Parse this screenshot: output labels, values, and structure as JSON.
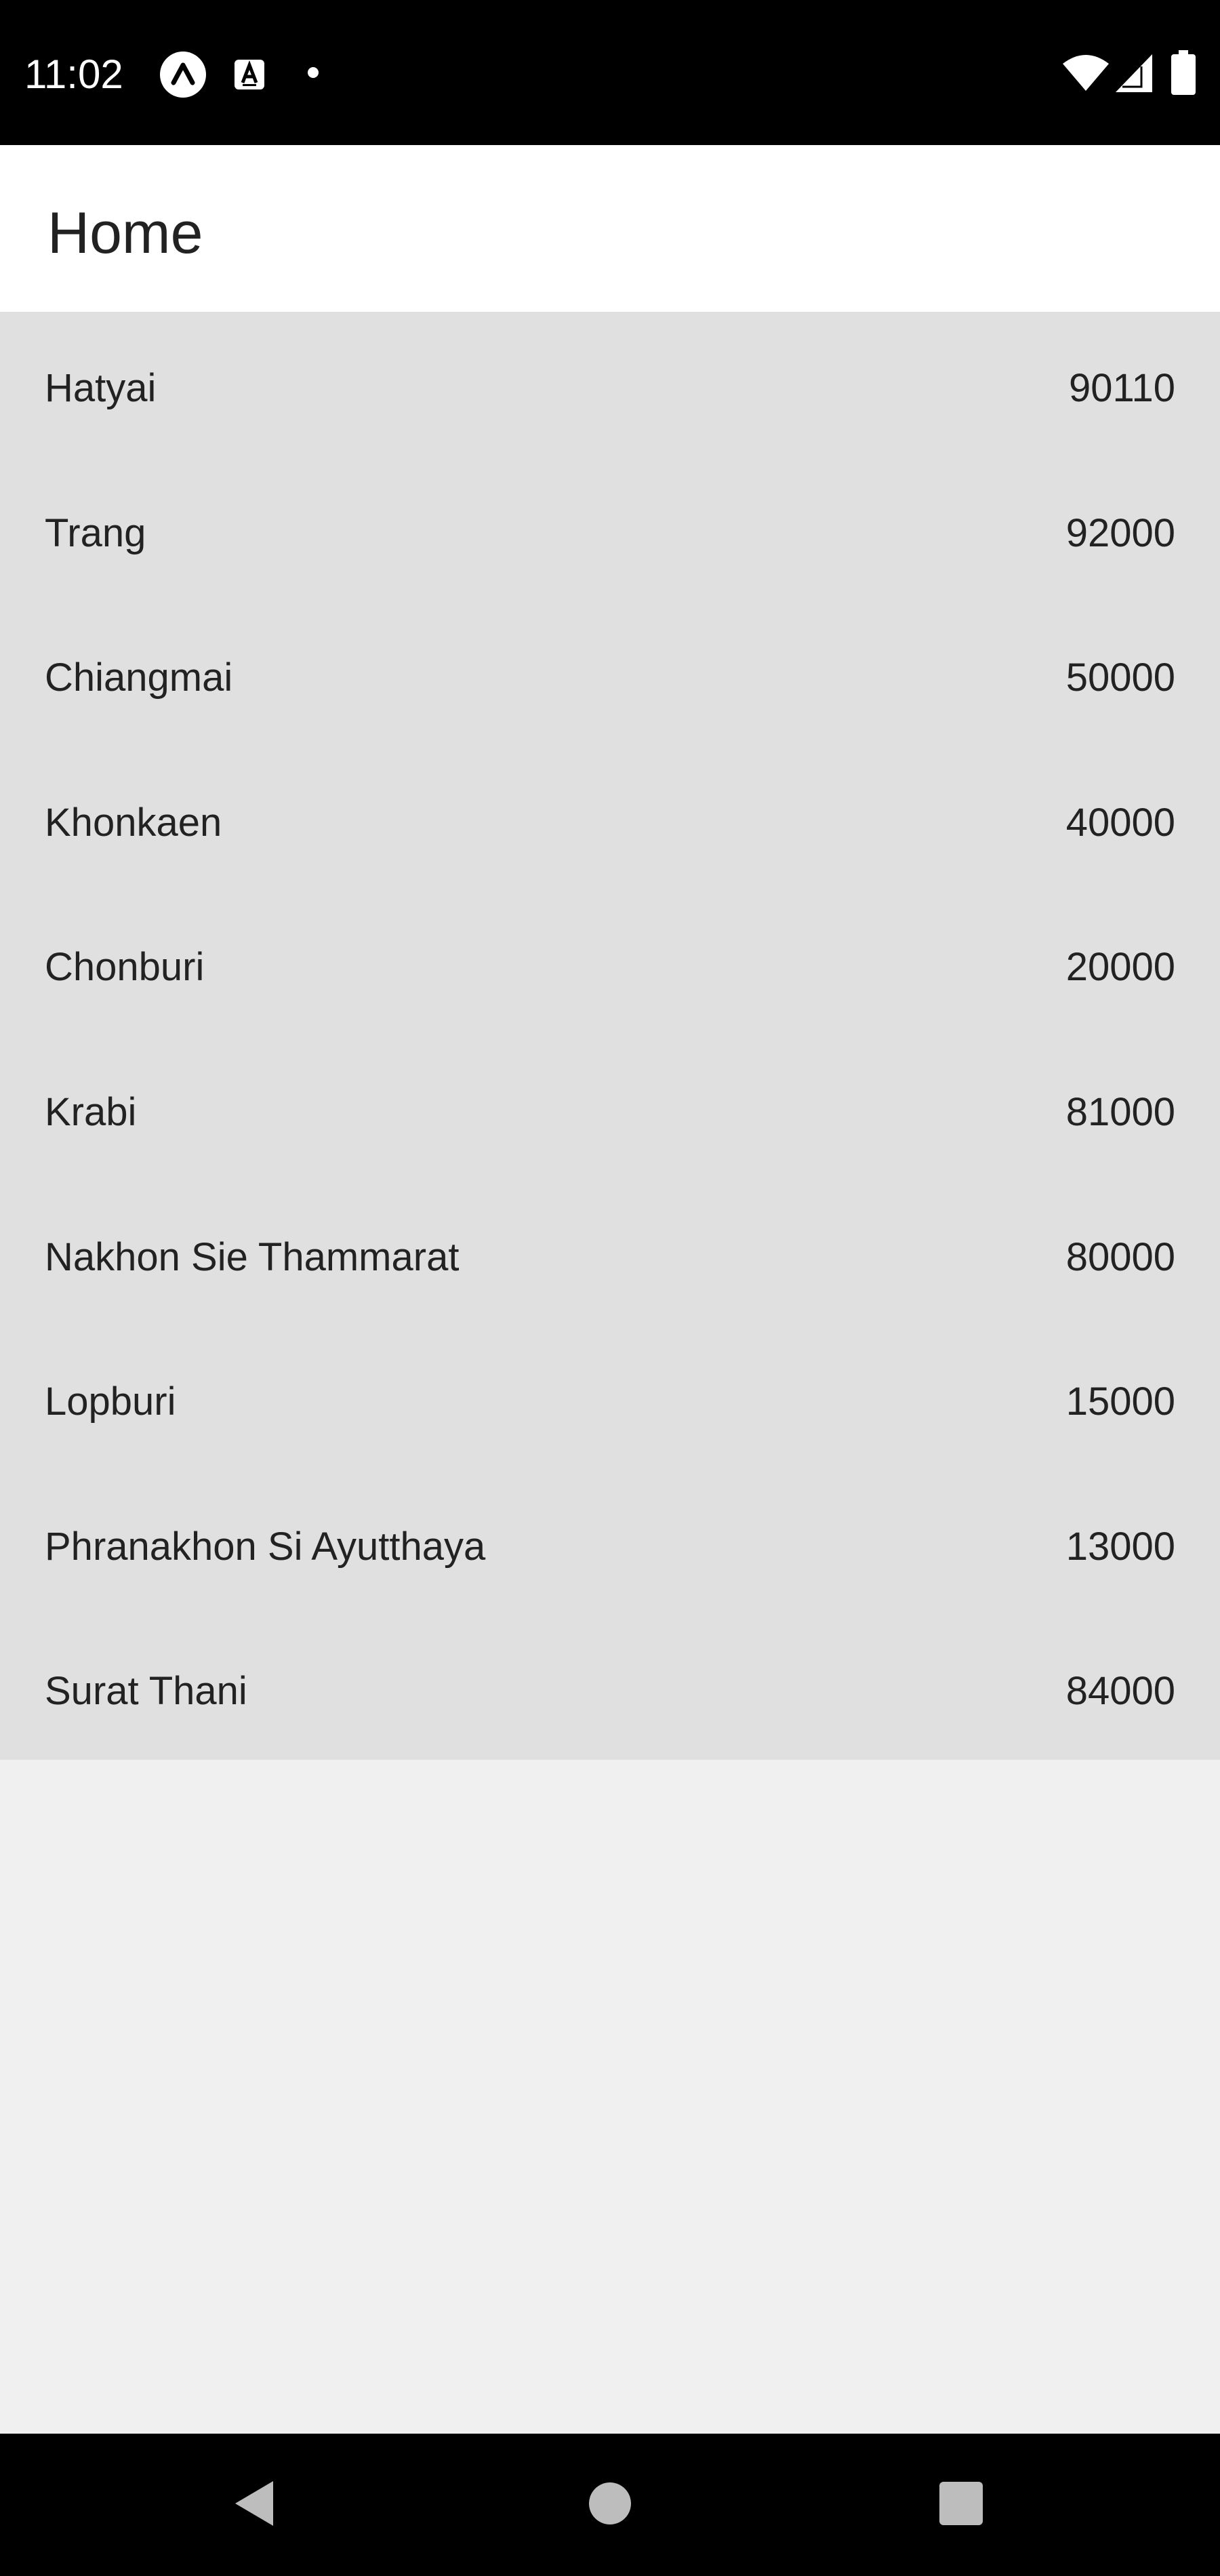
{
  "status_bar": {
    "time": "11:02",
    "icons_left": [
      "expo-icon",
      "keyboard-a-icon",
      "notification-dot-icon"
    ],
    "icons_right": [
      "wifi-icon",
      "cellular-signal-icon",
      "battery-icon"
    ]
  },
  "app_bar": {
    "title": "Home"
  },
  "list": {
    "items": [
      {
        "name": "Hatyai",
        "code": "90110"
      },
      {
        "name": "Trang",
        "code": "92000"
      },
      {
        "name": "Chiangmai",
        "code": "50000"
      },
      {
        "name": "Khonkaen",
        "code": "40000"
      },
      {
        "name": "Chonburi",
        "code": "20000"
      },
      {
        "name": "Krabi",
        "code": "81000"
      },
      {
        "name": "Nakhon Sie Thammarat",
        "code": "80000"
      },
      {
        "name": "Lopburi",
        "code": "15000"
      },
      {
        "name": "Phranakhon Si Ayutthaya",
        "code": "13000"
      },
      {
        "name": "Surat Thani",
        "code": "84000"
      }
    ]
  },
  "nav_bar": {
    "buttons": [
      "back-icon",
      "home-icon",
      "recents-icon"
    ]
  },
  "colors": {
    "list_background": "#e0e0e0",
    "page_background": "#f0f0f0",
    "app_bar_background": "#ffffff",
    "text": "#222222",
    "system_bars": "#000000"
  }
}
